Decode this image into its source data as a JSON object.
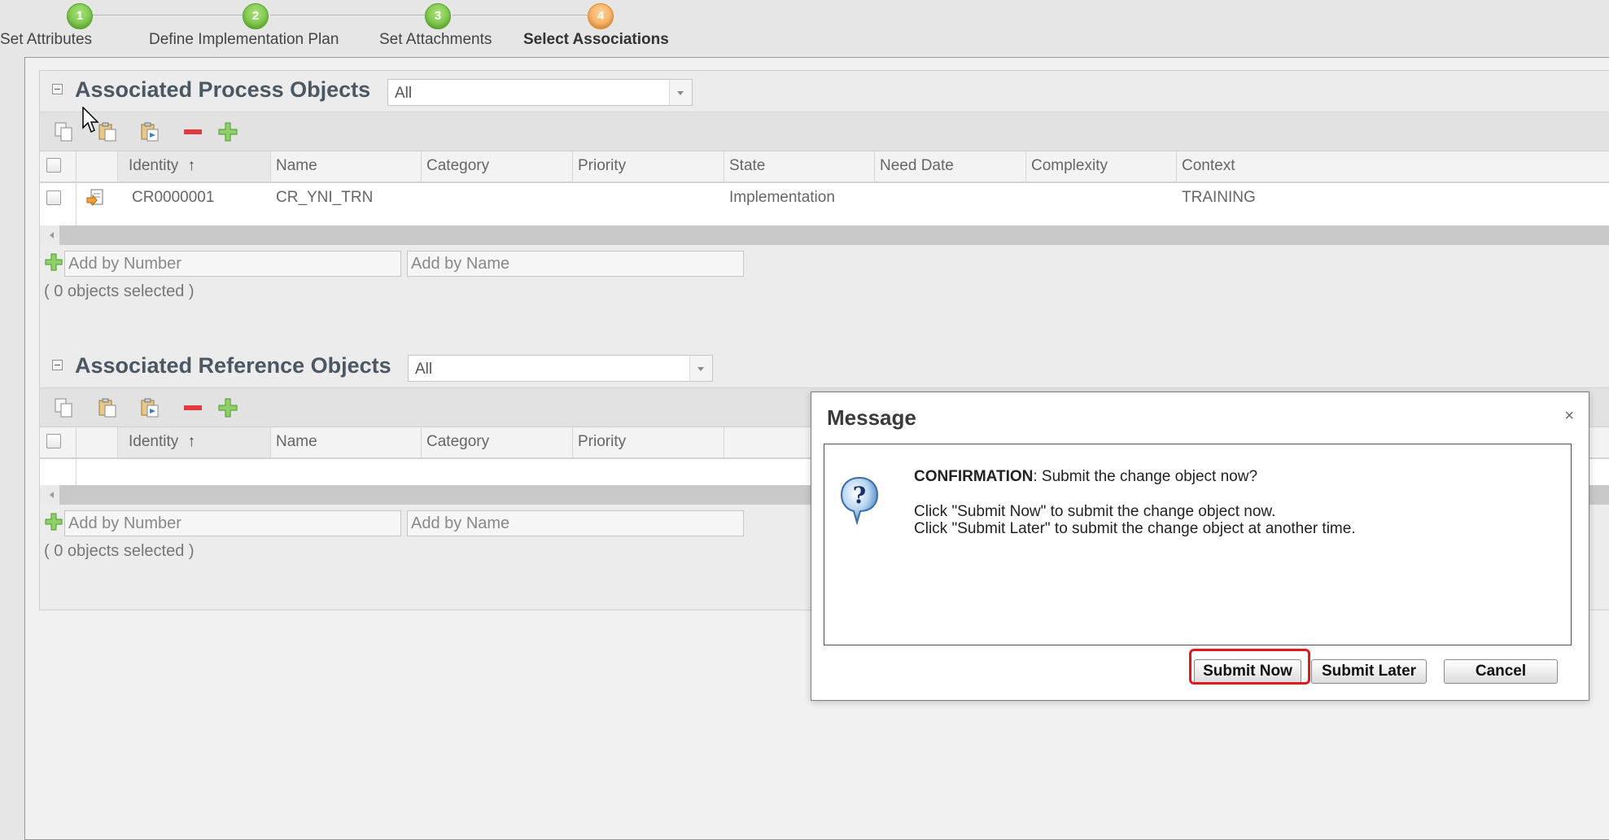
{
  "wizard": {
    "steps": [
      {
        "number": "1",
        "label": "Set Attributes"
      },
      {
        "number": "2",
        "label": "Define Implementation Plan"
      },
      {
        "number": "3",
        "label": "Set Attachments"
      },
      {
        "number": "4",
        "label": "Select Associations"
      }
    ]
  },
  "process_section": {
    "title": "Associated Process Objects",
    "filter_value": "All",
    "columns": [
      "Identity",
      "Name",
      "Category",
      "Priority",
      "State",
      "Need Date",
      "Complexity",
      "Context"
    ],
    "sort_indicator": "↑",
    "rows": [
      {
        "identity": "CR0000001",
        "name": "CR_YNI_TRN",
        "category": "",
        "priority": "",
        "state": "Implementation",
        "need_date": "",
        "complexity": "",
        "context": "TRAINING"
      }
    ],
    "add_by_number_placeholder": "Add by Number",
    "add_by_name_placeholder": "Add by Name",
    "selected_count": "( 0 objects selected )"
  },
  "reference_section": {
    "title": "Associated Reference Objects",
    "filter_value": "All",
    "columns": [
      "Identity",
      "Name",
      "Category",
      "Priority"
    ],
    "sort_indicator": "↑",
    "add_by_number_placeholder": "Add by Number",
    "add_by_name_placeholder": "Add by Name",
    "selected_count": "( 0 objects selected )"
  },
  "dialog": {
    "title": "Message",
    "close_glyph": "×",
    "confirmation_label": "CONFIRMATION",
    "confirmation_text": ": Submit the change object now?",
    "line1": "Click \"Submit Now\" to submit the change object now.",
    "line2": "Click \"Submit Later\" to submit the change object at another time.",
    "buttons": {
      "submit_now": "Submit Now",
      "submit_later": "Submit Later",
      "cancel": "Cancel"
    }
  },
  "icons": {
    "toolbar": [
      "copy-icon",
      "paste-icon",
      "paste-special-icon",
      "remove-icon",
      "add-icon"
    ],
    "row": "change-request-icon",
    "dialog": "question-icon"
  },
  "colors": {
    "step_done": "#6cbf3a",
    "step_active": "#f3a448",
    "highlight": "#e0191f",
    "title_text": "#4b5763"
  }
}
